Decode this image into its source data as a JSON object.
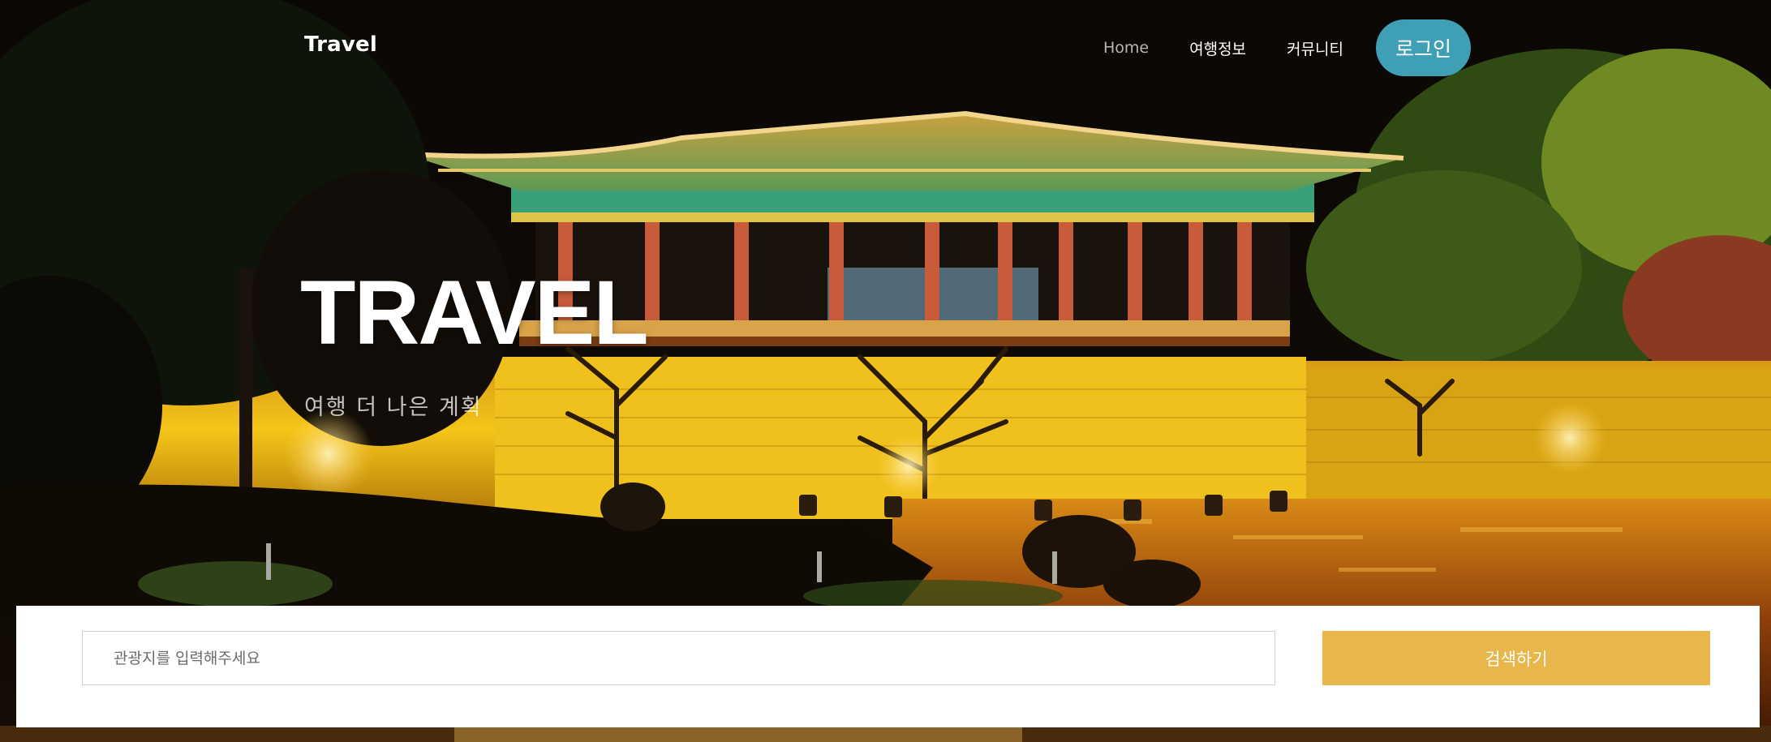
{
  "nav": {
    "brand": "Travel",
    "links": [
      "Home",
      "여행정보",
      "커뮤니티"
    ],
    "login": "로그인"
  },
  "hero": {
    "title": "TRAVEL",
    "subtitle": "여행 더 나은 계획"
  },
  "search": {
    "placeholder": "관광지를 입력해주세요",
    "button": "검색하기"
  },
  "colors": {
    "accent_login": "#3fa0b5",
    "accent_search": "#e8b64a"
  }
}
